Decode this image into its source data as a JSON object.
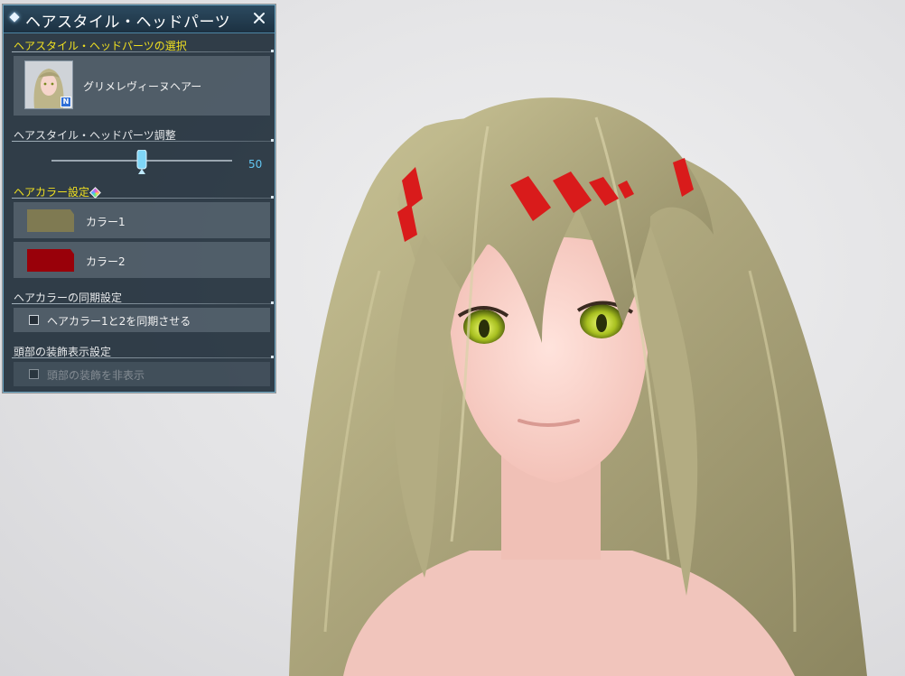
{
  "panel": {
    "title": "ヘアスタイル・ヘッドパーツ",
    "close_icon": "close-icon"
  },
  "hair_select": {
    "label": "ヘアスタイル・ヘッドパーツの選択",
    "item_name": "グリメレヴィーヌヘアー",
    "badge": "N"
  },
  "adjust": {
    "label": "ヘアスタイル・ヘッドパーツ調整",
    "slider_value": "50",
    "slider_level": 0.5
  },
  "hair_color": {
    "label": "ヘアカラー設定",
    "color1_label": "カラー1",
    "color1_hex": "#7f7a52",
    "color2_label": "カラー2",
    "color2_hex": "#990009"
  },
  "sync": {
    "label": "ヘアカラーの同期設定",
    "checkbox_label": "ヘアカラー1と2を同期させる",
    "checked": false
  },
  "head_accessory": {
    "label": "頭部の装飾表示設定",
    "checkbox_label": "頭部の装飾を非表示",
    "checked": false,
    "disabled": true
  },
  "colors": {
    "accent": "#62c6f2",
    "section_highlight": "#f0e020",
    "panel_border": "#6aa6c4"
  }
}
